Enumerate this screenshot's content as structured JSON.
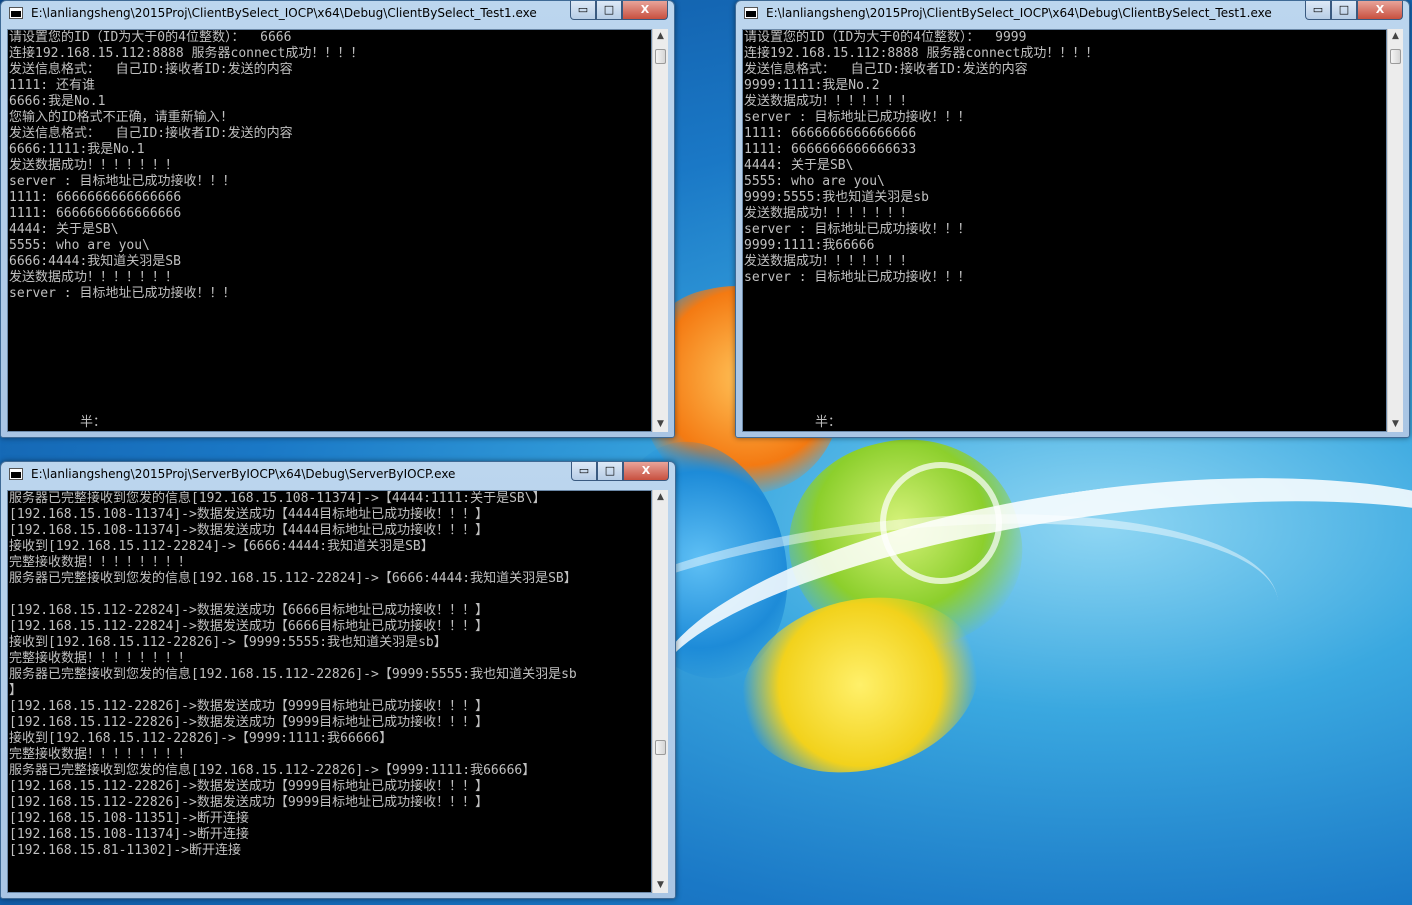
{
  "windows": {
    "client1": {
      "title": "E:\\lanliangsheng\\2015Proj\\ClientBySelect_IOCP\\x64\\Debug\\ClientBySelect_Test1.exe",
      "lines": [
        "请设置您的ID（ID为大于0的4位整数）：  6666",
        "连接192.168.15.112:8888 服务器connect成功！！！！",
        "发送信息格式：  自己ID:接收者ID:发送的内容",
        "1111: 还有谁",
        "6666:我是No.1",
        "您输入的ID格式不正确，请重新输入!",
        "发送信息格式：  自己ID:接收者ID:发送的内容",
        "6666:1111:我是No.1",
        "发送数据成功！！！！！！！",
        "server : 目标地址已成功接收！！！",
        "1111: 6666666666666666",
        "1111: 6666666666666666",
        "4444: 关于是SB\\",
        "5555: who are you\\",
        "6666:4444:我知道关羽是SB",
        "发送数据成功！！！！！！！",
        "server : 目标地址已成功接收！！！"
      ],
      "ime": "半："
    },
    "client2": {
      "title": "E:\\lanliangsheng\\2015Proj\\ClientBySelect_IOCP\\x64\\Debug\\ClientBySelect_Test1.exe",
      "lines": [
        "请设置您的ID（ID为大于0的4位整数）：  9999",
        "连接192.168.15.112:8888 服务器connect成功！！！！",
        "发送信息格式：  自己ID:接收者ID:发送的内容",
        "9999:1111:我是No.2",
        "发送数据成功！！！！！！！",
        "server : 目标地址已成功接收！！！",
        "1111: 6666666666666666",
        "1111: 6666666666666633",
        "4444: 关于是SB\\",
        "5555: who are you\\",
        "9999:5555:我也知道关羽是sb",
        "发送数据成功！！！！！！！",
        "server : 目标地址已成功接收！！！",
        "9999:1111:我66666",
        "发送数据成功！！！！！！！",
        "server : 目标地址已成功接收！！！"
      ],
      "ime": "半："
    },
    "server": {
      "title": "E:\\lanliangsheng\\2015Proj\\ServerByIOCP\\x64\\Debug\\ServerByIOCP.exe",
      "lines": [
        "服务器已完整接收到您发的信息[192.168.15.108-11374]->【4444:1111:关于是SB\\】",
        "[192.168.15.108-11374]->数据发送成功【4444目标地址已成功接收！！！】",
        "[192.168.15.108-11374]->数据发送成功【4444目标地址已成功接收！！！】",
        "接收到[192.168.15.112-22824]->【6666:4444:我知道关羽是SB】",
        "完整接收数据！！！！！！！！",
        "服务器已完整接收到您发的信息[192.168.15.112-22824]->【6666:4444:我知道关羽是SB】",
        "",
        "[192.168.15.112-22824]->数据发送成功【6666目标地址已成功接收！！！】",
        "[192.168.15.112-22824]->数据发送成功【6666目标地址已成功接收！！！】",
        "接收到[192.168.15.112-22826]->【9999:5555:我也知道关羽是sb】",
        "完整接收数据！！！！！！！！",
        "服务器已完整接收到您发的信息[192.168.15.112-22826]->【9999:5555:我也知道关羽是sb",
        "】",
        "[192.168.15.112-22826]->数据发送成功【9999目标地址已成功接收！！！】",
        "[192.168.15.112-22826]->数据发送成功【9999目标地址已成功接收！！！】",
        "接收到[192.168.15.112-22826]->【9999:1111:我66666】",
        "完整接收数据！！！！！！！！",
        "服务器已完整接收到您发的信息[192.168.15.112-22826]->【9999:1111:我66666】",
        "[192.168.15.112-22826]->数据发送成功【9999目标地址已成功接收！！！】",
        "[192.168.15.112-22826]->数据发送成功【9999目标地址已成功接收！！！】",
        "[192.168.15.108-11351]->断开连接",
        "[192.168.15.108-11374]->断开连接",
        "[192.168.15.81-11302]->断开连接"
      ]
    }
  },
  "controls": {
    "minimize": "▭",
    "maximize": "□",
    "close": "X"
  },
  "icons": {
    "scroll_up": "▲",
    "scroll_down": "▼"
  },
  "colors": {
    "console_bg": "#000000",
    "console_text": "#c0c0c0",
    "titlebar": "#bcd6ee"
  }
}
